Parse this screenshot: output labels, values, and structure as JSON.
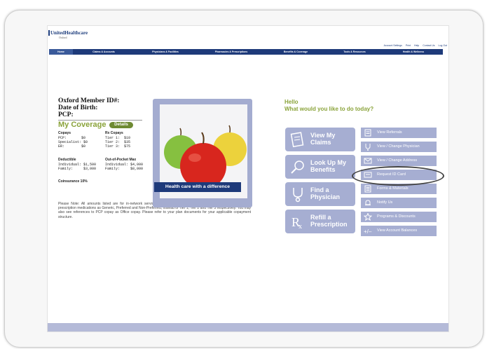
{
  "brand": {
    "name": "UnitedHealthcare",
    "sub": "Oxford"
  },
  "top_links": [
    "Account Settings",
    "Print",
    "Help",
    "Contact Us",
    "Log Out"
  ],
  "nav": [
    "Home",
    "Claims & Accounts",
    "Physicians & Facilities",
    "Pharmacies & Prescriptions",
    "Benefits & Coverage",
    "Tools & Resources",
    "Health & Wellness"
  ],
  "member": {
    "id_label": "Oxford Member ID#:",
    "dob_label": "Date of Birth:",
    "pcp_label": "PCP:"
  },
  "coverage": {
    "title": "My Coverage",
    "details_label": "Details",
    "copays_title": "Copays",
    "copays": "PCP:       $0\nSpecialist: $0\nER:        $0",
    "rx_title": "Rx Copays",
    "rx": "Tier 1:  $10\nTier 2:  $35\nTier 3:  $75",
    "deductible_title": "Deductible",
    "deductible": "Individual: $1,500\nFamily:     $3,000",
    "oop_title": "Out-of-Pocket Max",
    "oop": "Individual: $4,000\nFamily:     $8,000",
    "coinsurance": "Coinsurance 10%"
  },
  "note": "Please Note: All amounts listed are for in-network service only. Some plans have a copayment structure that lists prescription medications as Generic, Preferred and Non-Preferred, instead of Tier 1, Tier 2 and Tier 3 respectively. You may also see references to PCP copay as Office copay. Please refer to your plan documents for your applicable copayment structure.",
  "banner": "Health care with a difference",
  "greeting": {
    "hello": "Hello",
    "question": "What would you like to do today?"
  },
  "big_buttons": [
    {
      "label": "View My Claims",
      "icon": "claims-icon"
    },
    {
      "label": "Look Up My Benefits",
      "icon": "magnifier-icon"
    },
    {
      "label": "Find a Physician",
      "icon": "stethoscope-icon"
    },
    {
      "label": "Refill a Prescription",
      "icon": "rx-icon"
    }
  ],
  "small_buttons": [
    {
      "label": "View Referrals",
      "icon": "document-icon"
    },
    {
      "label": "View / Change Physician",
      "icon": "stethoscope-icon"
    },
    {
      "label": "View / Change Address",
      "icon": "envelope-icon"
    },
    {
      "label": "Request ID Card",
      "icon": "id-card-icon"
    },
    {
      "label": "Forms & Materials",
      "icon": "forms-icon"
    },
    {
      "label": "Notify Us",
      "icon": "bell-icon"
    },
    {
      "label": "Programs & Discounts",
      "icon": "star-icon"
    },
    {
      "label": "View Account Balances",
      "icon": "plus-minus-icon"
    }
  ],
  "colors": {
    "nav": "#1e3a7a",
    "button": "#a6aed2",
    "accent_green": "#8aa33a"
  }
}
